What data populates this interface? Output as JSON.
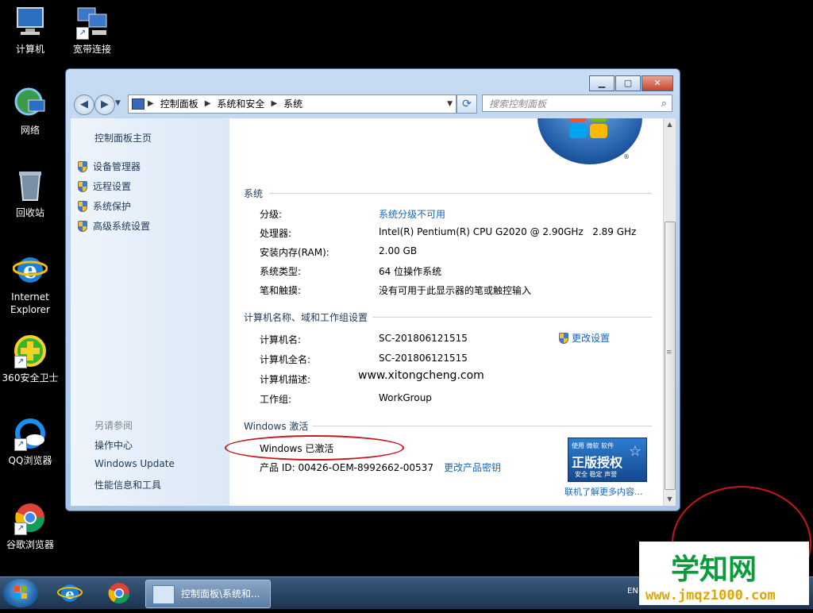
{
  "desktop": {
    "icons": [
      {
        "label": "计算机"
      },
      {
        "label": "宽带连接"
      },
      {
        "label": "网络"
      },
      {
        "label": "回收站"
      },
      {
        "label": "Internet Explorer"
      },
      {
        "label": "360安全卫士"
      },
      {
        "label": "QQ浏览器"
      },
      {
        "label": "谷歌浏览器"
      }
    ]
  },
  "window": {
    "breadcrumbs": [
      "控制面板",
      "系统和安全",
      "系统"
    ],
    "search_placeholder": "搜索控制面板",
    "sidepane": {
      "home": "控制面板主页",
      "tasks": [
        "设备管理器",
        "远程设置",
        "系统保护",
        "高级系统设置"
      ],
      "see_also": "另请参阅",
      "links": [
        "操作中心",
        "Windows Update",
        "性能信息和工具"
      ]
    },
    "system": {
      "heading": "系统",
      "rows": [
        {
          "label": "分级:",
          "value": "系统分级不可用"
        },
        {
          "label": "处理器:",
          "value": "Intel(R) Pentium(R) CPU G2020 @ 2.90GHz   2.89 GHz"
        },
        {
          "label": "安装内存(RAM):",
          "value": "2.00 GB"
        },
        {
          "label": "系统类型:",
          "value": "64 位操作系统"
        },
        {
          "label": "笔和触摸:",
          "value": "没有可用于此显示器的笔或触控输入"
        }
      ]
    },
    "computer": {
      "heading": "计算机名称、域和工作组设置",
      "change_settings": "更改设置",
      "rows": [
        {
          "label": "计算机名:",
          "value": "SC-201806121515"
        },
        {
          "label": "计算机全名:",
          "value": "SC-201806121515"
        },
        {
          "label": "计算机描述:",
          "value": "www.xitongcheng.com"
        },
        {
          "label": "工作组:",
          "value": "WorkGroup"
        }
      ]
    },
    "activation": {
      "heading": "Windows 激活",
      "status": "Windows 已激活",
      "product_id": "产品 ID: 00426-OEM-8992662-00537",
      "change_key": "更改产品密钥",
      "genuine_top": "使用 微软 软件",
      "genuine_main": "正版授权",
      "genuine_bottom": "安全 稳定 声誉",
      "learn_more": "联机了解更多内容..."
    }
  },
  "taskbar": {
    "task_label": "控制面板\\系统和...",
    "tray_text": "EN"
  },
  "watermark": {
    "big": "学知网",
    "small": "www.jmqz1000.com"
  },
  "colors": {
    "accent_link": "#1565b8",
    "annotation_red": "#c8161d",
    "watermark_green": "#0b9c3a",
    "watermark_yellow": "#e0a600"
  }
}
